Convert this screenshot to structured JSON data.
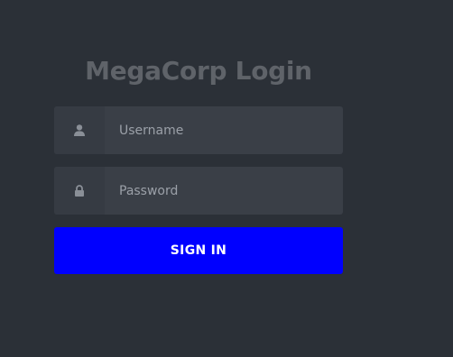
{
  "login": {
    "title": "MegaCorp Login",
    "username": {
      "value": "",
      "placeholder": "Username",
      "icon": "user-icon"
    },
    "password": {
      "value": "",
      "placeholder": "Password",
      "icon": "lock-icon"
    },
    "submit_label": "SIGN IN"
  },
  "colors": {
    "background": "#2b3037",
    "field_background": "#3a3f47",
    "icon_cell_background": "#363b43",
    "button": "#0000ff",
    "title": "#5f6369"
  }
}
